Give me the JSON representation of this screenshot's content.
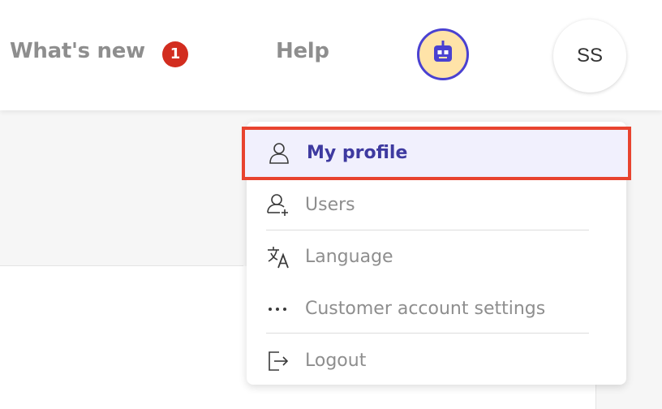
{
  "header": {
    "whats_new_label": "What's new",
    "whats_new_badge": "1",
    "help_label": "Help",
    "avatar_initials": "SS"
  },
  "menu": {
    "items": [
      {
        "label": "My profile",
        "icon": "user-icon",
        "highlighted": true
      },
      {
        "label": "Users",
        "icon": "user-plus-icon"
      },
      {
        "label": "Language",
        "icon": "translate-icon"
      },
      {
        "label": "Customer account settings",
        "icon": "more-horizontal-icon"
      },
      {
        "label": "Logout",
        "icon": "logout-icon"
      }
    ]
  },
  "colors": {
    "accent": "#3e3aa0",
    "highlight_border": "#e8432f",
    "badge": "#d22d1f",
    "bot_bg": "#ffe3a8",
    "bot_ring": "#4a41d1",
    "muted_text": "#8e8e8e"
  }
}
